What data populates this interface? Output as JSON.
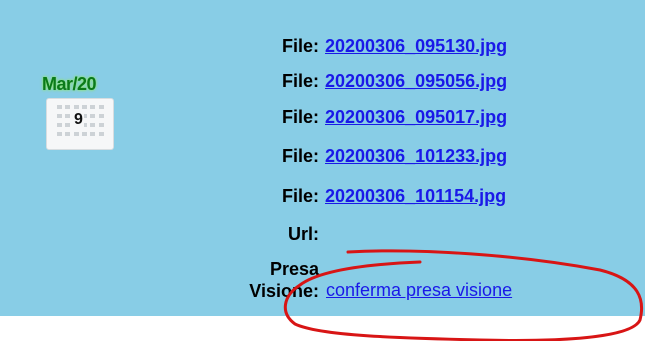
{
  "calendar": {
    "month": "Mar/20",
    "day": "9"
  },
  "files": [
    {
      "label": "File:",
      "name": "20200306_095130.jpg"
    },
    {
      "label": "File:",
      "name": "20200306_095056.jpg"
    },
    {
      "label": "File:",
      "name": "20200306_095017.jpg"
    },
    {
      "label": "File:",
      "name": "20200306_101233.jpg"
    },
    {
      "label": "File:",
      "name": "20200306_101154.jpg"
    }
  ],
  "url": {
    "label": "Url:",
    "value": ""
  },
  "presa_visione": {
    "label_line1": "Presa",
    "label_line2": "Visione:",
    "link_text": "conferma presa visione"
  },
  "colors": {
    "panel_bg": "#88cde6",
    "link": "#1a19e8",
    "annotation": "#d81515",
    "calendar_month": "#0a7a1a"
  }
}
